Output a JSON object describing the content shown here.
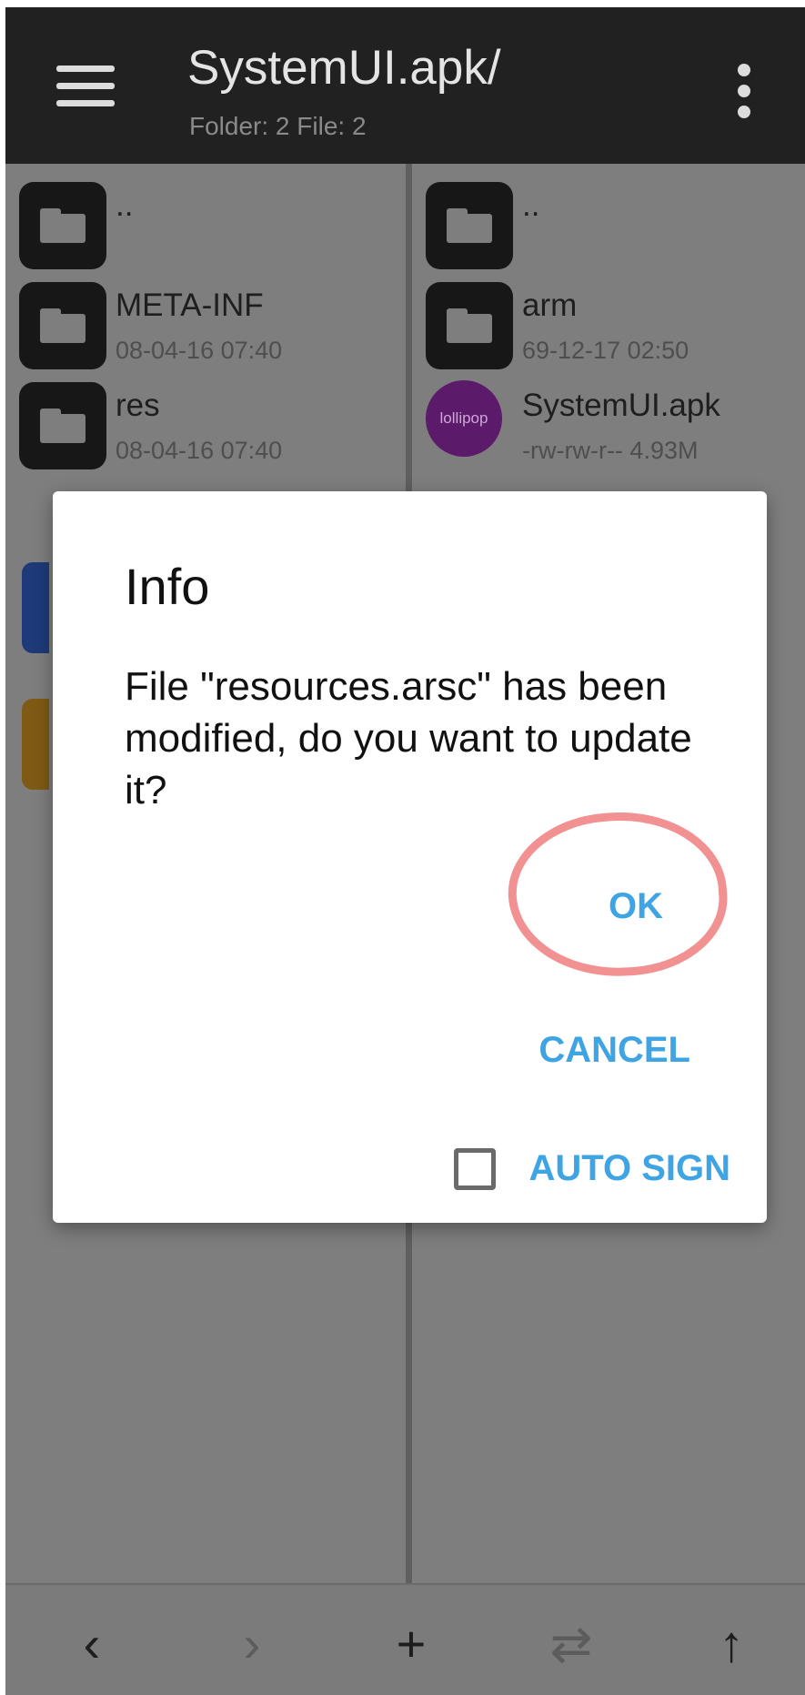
{
  "header": {
    "title": "SystemUI.apk/",
    "subtitle": "Folder: 2  File: 2",
    "menu_icon": "menu-icon",
    "overflow_icon": "more-vert-icon"
  },
  "left_pane": {
    "items": [
      {
        "name": "..",
        "meta": ""
      },
      {
        "name": "META-INF",
        "meta": "08-04-16 07:40"
      },
      {
        "name": "res",
        "meta": "08-04-16 07:40"
      }
    ]
  },
  "right_pane": {
    "items": [
      {
        "name": "..",
        "meta": ""
      },
      {
        "name": "arm",
        "meta": "69-12-17 02:50"
      },
      {
        "name": "SystemUI.apk",
        "meta": "-rw-rw-r--  4.93M",
        "icon_text": "lollipop"
      }
    ]
  },
  "dialog": {
    "title": "Info",
    "message": "File \"resources.arsc\" has been modified, do you want to update it?",
    "ok_label": "OK",
    "cancel_label": "CANCEL",
    "auto_sign_label": "AUTO SIGN",
    "auto_sign_checked": false
  },
  "toolbar": {
    "back": "‹",
    "forward": "›",
    "add": "+",
    "swap": "⇄",
    "up": "↑"
  },
  "colors": {
    "header_bg": "#212121",
    "pane_bg": "#7e7e7e",
    "accent": "#3ea4e3",
    "highlight": "#f18b8b"
  }
}
